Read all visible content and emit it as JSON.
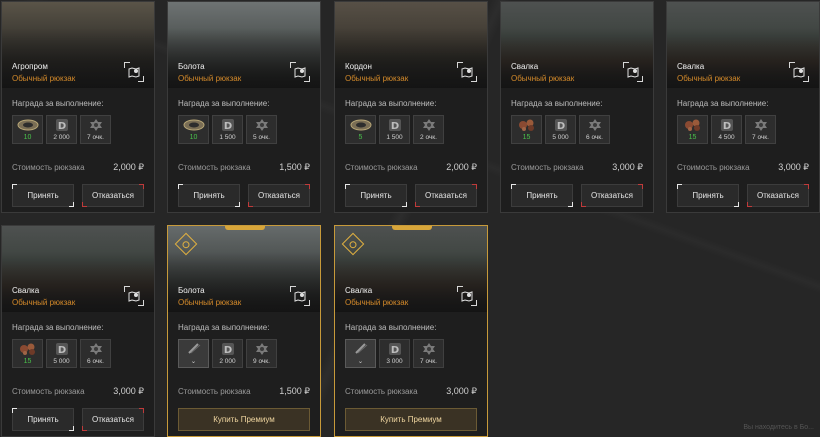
{
  "labels": {
    "reward": "Награда за выполнение:",
    "cost": "Стоимость рюкзака",
    "accept": "Принять",
    "decline": "Отказаться",
    "buy_premium": "Купить Премиум"
  },
  "currency_symbol": "₽",
  "footer_note": "Вы находитесь в Бо...",
  "cards": [
    {
      "location": "Агропром",
      "type": "Обычный рюкзак",
      "item_count": "10",
      "item_icon": "bolt-coil-icon",
      "points": "2 000",
      "score": "7 очк.",
      "cost": "2,000",
      "premium": false
    },
    {
      "location": "Болота",
      "type": "Обычный рюкзак",
      "item_count": "10",
      "item_icon": "bolt-coil-icon",
      "points": "1 500",
      "score": "5 очк.",
      "cost": "1,500",
      "premium": false
    },
    {
      "location": "Кордон",
      "type": "Обычный рюкзак",
      "item_count": "5",
      "item_icon": "bolt-coil-icon",
      "points": "1 500",
      "score": "2 очк.",
      "cost": "2,000",
      "premium": false
    },
    {
      "location": "Свалка",
      "type": "Обычный рюкзак",
      "item_count": "15",
      "item_icon": "rusty-parts-icon",
      "points": "5 000",
      "score": "6 очк.",
      "cost": "3,000",
      "premium": false
    },
    {
      "location": "Свалка",
      "type": "Обычный рюкзак",
      "item_count": "15",
      "item_icon": "rusty-parts-icon",
      "points": "4 500",
      "score": "7 очк.",
      "cost": "3,000",
      "premium": false
    },
    {
      "location": "Свалка",
      "type": "Обычный рюкзак",
      "item_count": "15",
      "item_icon": "rusty-parts-icon",
      "points": "5 000",
      "score": "6 очк.",
      "cost": "3,000",
      "premium": false
    },
    {
      "location": "Болота",
      "type": "Обычный рюкзак",
      "item_count": "",
      "item_icon": "locked-item-icon",
      "points": "2 000",
      "score": "9 очк.",
      "cost": "1,500",
      "premium": true
    },
    {
      "location": "Свалка",
      "type": "Обычный рюкзак",
      "item_count": "",
      "item_icon": "locked-item-icon",
      "points": "3 000",
      "score": "7 очк.",
      "cost": "3,000",
      "premium": true
    }
  ],
  "colors": {
    "accent_orange": "#d48a2a",
    "premium_gold": "#d8a63a",
    "count_green": "#49c24a",
    "decline_red": "#c03a3a"
  }
}
